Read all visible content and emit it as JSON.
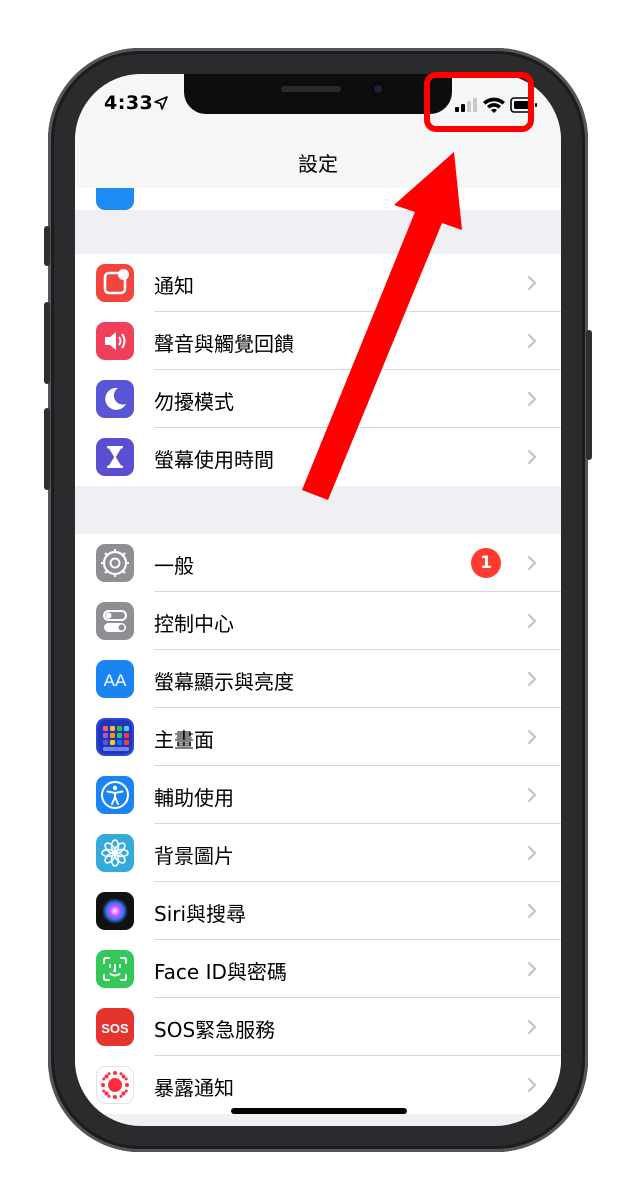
{
  "status_bar": {
    "time": "4:33"
  },
  "nav": {
    "title": "設定"
  },
  "groups": [
    {
      "items": [
        {
          "label": "通知"
        },
        {
          "label": "聲音與觸覺回饋"
        },
        {
          "label": "勿擾模式"
        },
        {
          "label": "螢幕使用時間"
        }
      ]
    },
    {
      "items": [
        {
          "label": "一般",
          "badge": "1"
        },
        {
          "label": "控制中心"
        },
        {
          "label": "螢幕顯示與亮度",
          "icon_text": "AA"
        },
        {
          "label": "主畫面"
        },
        {
          "label": "輔助使用"
        },
        {
          "label": "背景圖片"
        },
        {
          "label": "Siri與搜尋"
        },
        {
          "label": "Face ID與密碼"
        },
        {
          "label": "SOS緊急服務",
          "icon_text": "SOS"
        },
        {
          "label": "暴露通知"
        }
      ]
    }
  ],
  "colors": {
    "accent_red": "#ff0000",
    "badge": "#ff3b30",
    "notifications_icon": "#f2453d",
    "sounds_icon": "#ef3f5b",
    "dnd_icon": "#5856d6",
    "screentime_icon": "#5b4fd1",
    "general_icon": "#8e8e93",
    "display_icon": "#1a84f5",
    "sos_icon": "#e5342d"
  }
}
